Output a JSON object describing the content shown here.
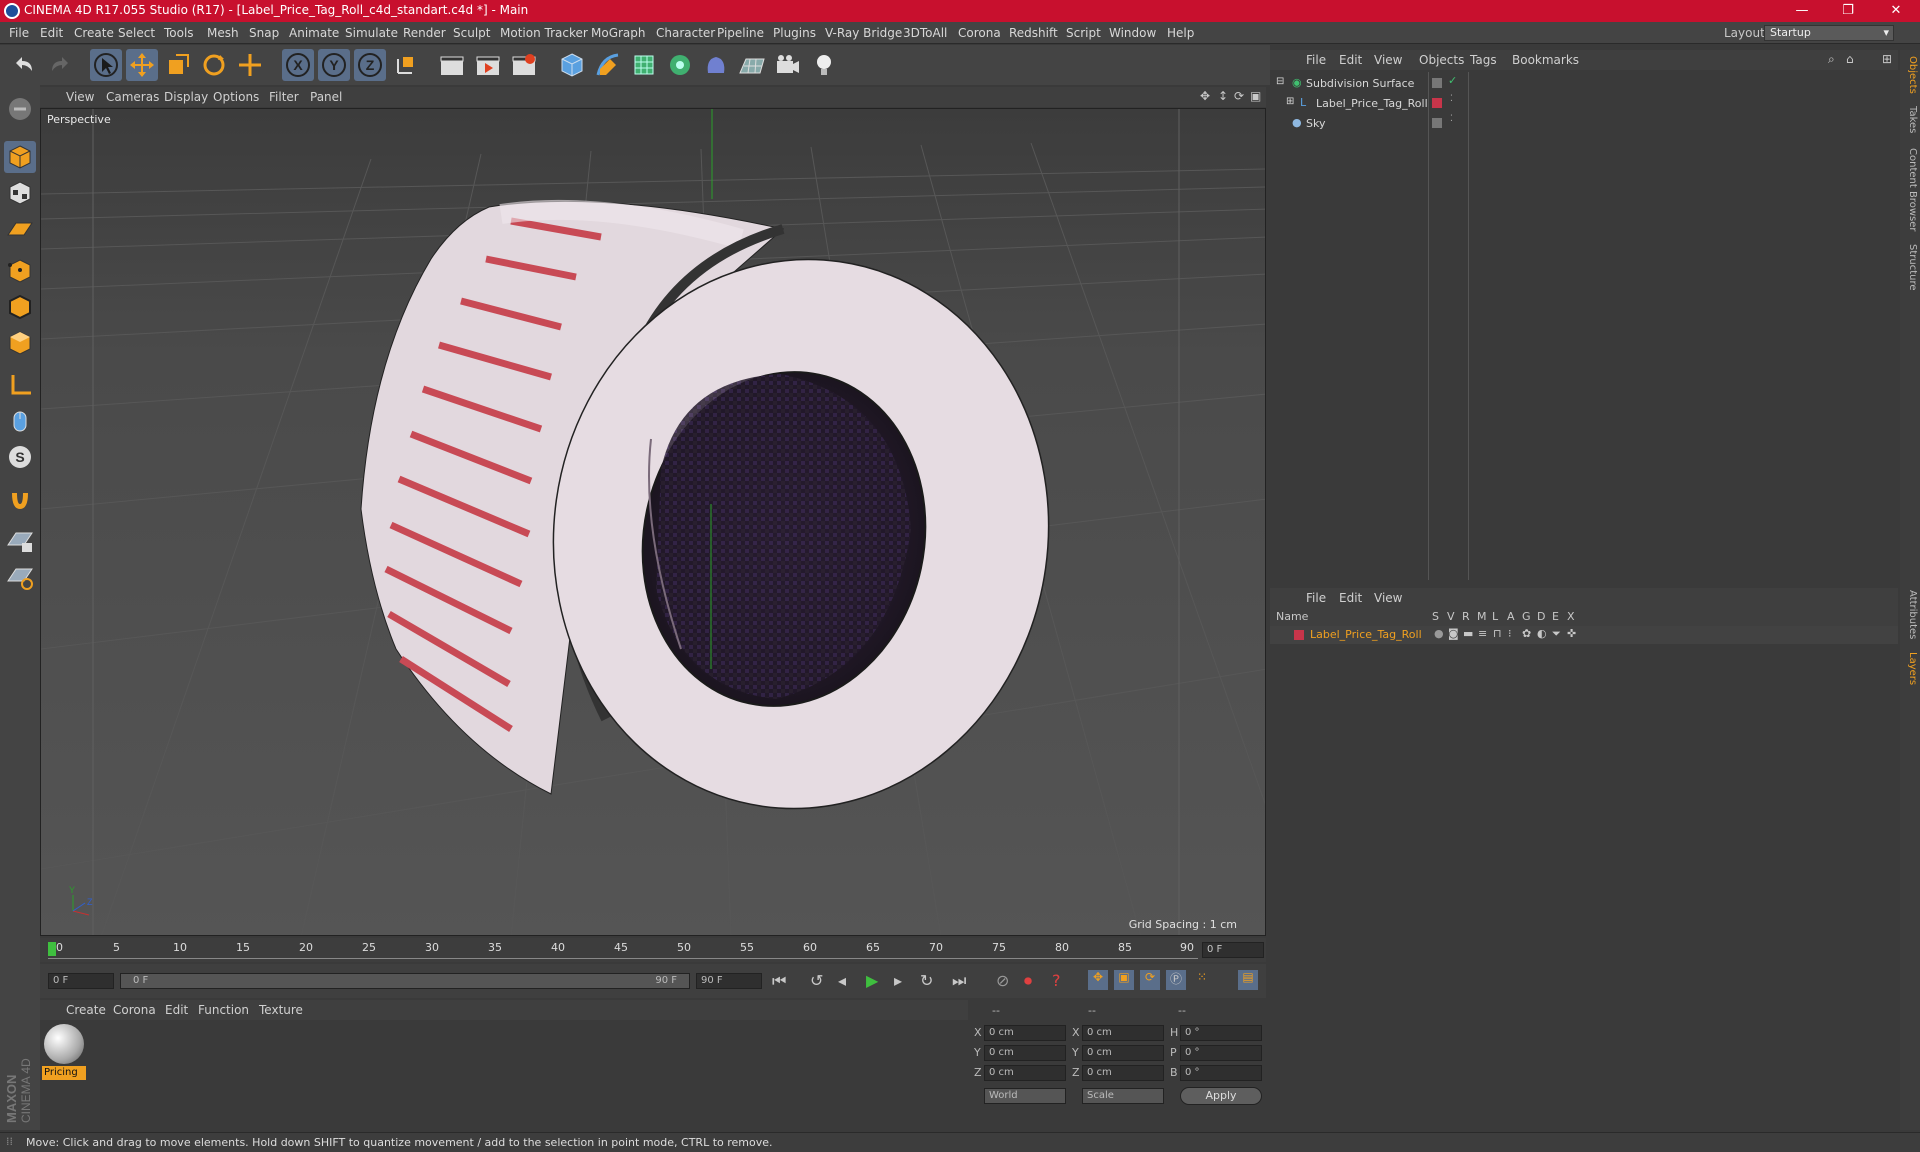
{
  "window": {
    "title": "CINEMA 4D R17.055 Studio (R17) - [Label_Price_Tag_Roll_c4d_standart.c4d *] - Main",
    "minimize": "—",
    "maximize": "❐",
    "close": "✕"
  },
  "menubar": {
    "items": [
      "File",
      "Edit",
      "Create",
      "Select",
      "Tools",
      "Mesh",
      "Snap",
      "Animate",
      "Simulate",
      "Render",
      "Sculpt",
      "Motion Tracker",
      "MoGraph",
      "Character",
      "Pipeline",
      "Plugins",
      "V-Ray Bridge",
      "3DToAll",
      "Corona",
      "Redshift",
      "Script",
      "Window",
      "Help"
    ],
    "layout_label": "Layout:",
    "layout_value": "Startup"
  },
  "viewport": {
    "menu": [
      "View",
      "Cameras",
      "Display",
      "Options",
      "Filter",
      "Panel"
    ],
    "camera_label": "Perspective",
    "grid_spacing": "Grid Spacing : 1 cm"
  },
  "timeline": {
    "ticks": [
      "0",
      "5",
      "10",
      "15",
      "20",
      "25",
      "30",
      "35",
      "40",
      "45",
      "50",
      "55",
      "60",
      "65",
      "70",
      "75",
      "80",
      "85",
      "90"
    ],
    "current_frame": "0 F",
    "start_field": "0 F",
    "range_start": "0 F",
    "range_end": "90 F",
    "end_field": "90 F"
  },
  "material_manager": {
    "menu": [
      "Create",
      "Corona",
      "Edit",
      "Function",
      "Texture"
    ],
    "materials": [
      {
        "name": "Pricing"
      }
    ]
  },
  "coordinates": {
    "header": [
      "--",
      "--",
      "--"
    ],
    "rows": [
      {
        "axis": "X",
        "pos": "0 cm",
        "axis2": "X",
        "size": "0 cm",
        "axis3": "H",
        "rot": "0 °"
      },
      {
        "axis": "Y",
        "pos": "0 cm",
        "axis2": "Y",
        "size": "0 cm",
        "axis3": "P",
        "rot": "0 °"
      },
      {
        "axis": "Z",
        "pos": "0 cm",
        "axis2": "Z",
        "size": "0 cm",
        "axis3": "B",
        "rot": "0 °"
      }
    ],
    "coord_mode": "World",
    "size_mode": "Scale",
    "apply_label": "Apply"
  },
  "object_manager": {
    "menu": [
      "File",
      "Edit",
      "View",
      "Objects",
      "Tags",
      "Bookmarks"
    ],
    "objects": [
      {
        "name": "Subdivision Surface"
      },
      {
        "name": "Label_Price_Tag_Roll"
      },
      {
        "name": "Sky"
      }
    ]
  },
  "layer_manager": {
    "menu": [
      "File",
      "Edit",
      "View"
    ],
    "columns": [
      "Name",
      "S",
      "V",
      "R",
      "M",
      "L",
      "A",
      "G",
      "D",
      "E",
      "X"
    ],
    "layers": [
      {
        "name": "Label_Price_Tag_Roll"
      }
    ]
  },
  "right_tabs": [
    "Objects",
    "Takes",
    "Content Browser",
    "Structure",
    "Attributes",
    "Layers"
  ],
  "status": {
    "text": "Move: Click and drag to move elements. Hold down SHIFT to quantize movement / add to the selection in point mode, CTRL to remove."
  },
  "brand": {
    "logo_text": "MAXON CINEMA 4D"
  },
  "colors": {
    "titlebar": "#c8102e",
    "accent_orange": "#f0a020",
    "layer_red": "#c8354a"
  }
}
